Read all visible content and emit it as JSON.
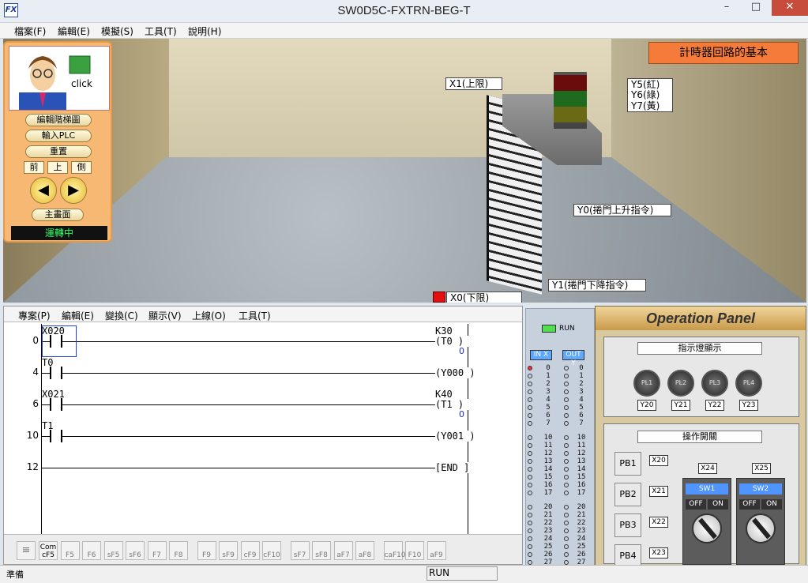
{
  "window": {
    "title": "SW0D5C-FXTRN-BEG-T",
    "icon_label": "FX",
    "minimize": "–",
    "maximize": "□",
    "close": "✕"
  },
  "menubar": [
    "檔案(F)",
    "編輯(E)",
    "模擬(S)",
    "工具(T)",
    "說明(H)"
  ],
  "scene": {
    "title": "計時器回路的基本",
    "labels": {
      "x1": "X1(上限)",
      "y5": "Y5(紅)",
      "y6": "Y6(綠)",
      "y7": "Y7(黃)",
      "y0": "Y0(捲門上升指令)",
      "y1": "Y1(捲門下降指令)",
      "x0": "X0(下限)"
    }
  },
  "control_panel": {
    "click_label": "click",
    "edit_ladder": "編輯階梯圖",
    "write_plc": "輸入PLC",
    "reset": "重置",
    "view_front": "前",
    "view_top": "上",
    "view_side": "側",
    "prev_icon": "◀",
    "next_icon": "▶",
    "main_screen": "主畫面",
    "status": "運轉中"
  },
  "ladder": {
    "menu": [
      "專案(P)",
      "編輯(E)",
      "變換(C)",
      "顯示(V)",
      "上線(O)",
      "工具(T)"
    ],
    "rungs": [
      {
        "step": "0",
        "contact": "X020",
        "coil": "K30",
        "coil2": "(T0",
        "value": "0"
      },
      {
        "step": "4",
        "contact": "T0",
        "coil": "(Y000",
        "coil2": "",
        "value": ""
      },
      {
        "step": "6",
        "contact": "X021",
        "coil": "K40",
        "coil2": "(T1",
        "value": "0"
      },
      {
        "step": "10",
        "contact": "T1",
        "coil": "(Y001",
        "coil2": "",
        "value": ""
      },
      {
        "step": "12",
        "contact": "",
        "coil": "[END",
        "coil2": "",
        "value": ""
      }
    ],
    "toolbar": [
      "Com cF5",
      "F5",
      "F6",
      "sF5",
      "sF6",
      "F7",
      "F8",
      "F9",
      "sF9",
      "cF9",
      "cF10",
      "sF7",
      "sF8",
      "aF7",
      "aF8",
      "caF10",
      "F10",
      "aF9"
    ]
  },
  "statusbar": {
    "left": "準備",
    "mode": "RUN"
  },
  "io_monitor": {
    "run": "RUN",
    "in_header": "IN X",
    "out_header": "OUT Y",
    "rows": [
      "0",
      "1",
      "2",
      "3",
      "4",
      "5",
      "6",
      "7",
      "10",
      "11",
      "12",
      "13",
      "14",
      "15",
      "16",
      "17",
      "20",
      "21",
      "22",
      "23",
      "24",
      "25",
      "26",
      "27"
    ],
    "active_inputs": [
      "0"
    ]
  },
  "operation_panel": {
    "title": "Operation Panel",
    "lamp_section": "指示燈顯示",
    "lamps": [
      {
        "name": "PL1",
        "addr": "Y20"
      },
      {
        "name": "PL2",
        "addr": "Y21"
      },
      {
        "name": "PL3",
        "addr": "Y22"
      },
      {
        "name": "PL4",
        "addr": "Y23"
      }
    ],
    "switch_section": "操作開關",
    "buttons": [
      {
        "name": "PB1",
        "addr": "X20"
      },
      {
        "name": "PB2",
        "addr": "X21"
      },
      {
        "name": "PB3",
        "addr": "X22"
      },
      {
        "name": "PB4",
        "addr": "X23"
      }
    ],
    "switches": [
      {
        "name": "SW1",
        "addr": "X24",
        "off": "OFF",
        "on": "ON"
      },
      {
        "name": "SW2",
        "addr": "X25",
        "off": "OFF",
        "on": "ON"
      }
    ]
  }
}
